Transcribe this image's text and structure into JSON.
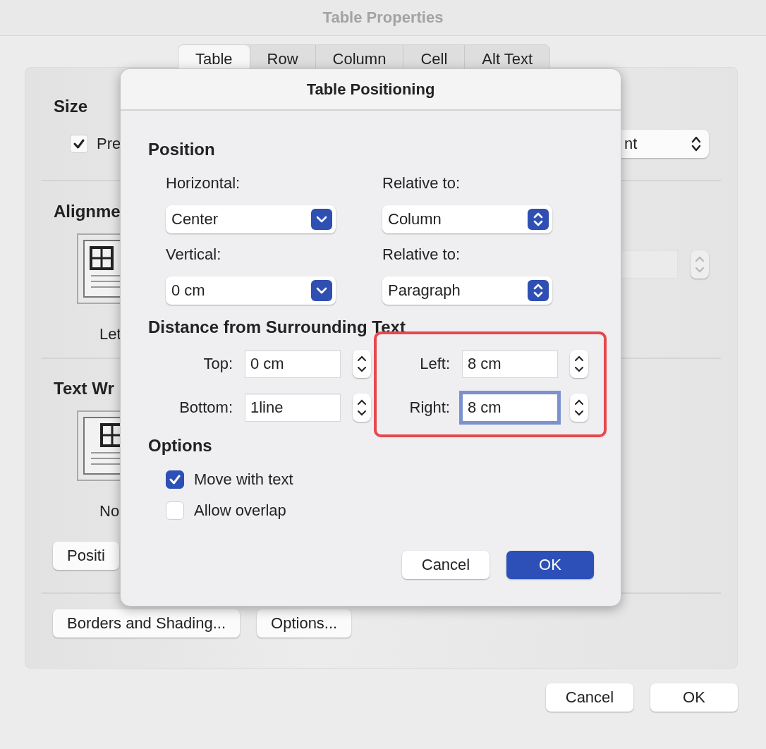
{
  "window": {
    "title": "Table Properties"
  },
  "tabs": [
    {
      "label": "Table",
      "selected": true
    },
    {
      "label": "Row",
      "selected": false
    },
    {
      "label": "Column",
      "selected": false
    },
    {
      "label": "Cell",
      "selected": false
    },
    {
      "label": "Alt Text",
      "selected": false
    }
  ],
  "size": {
    "heading": "Size",
    "checkbox": {
      "label": "Pre",
      "checked": true
    },
    "unit_select": {
      "value": "nt"
    }
  },
  "alignment": {
    "heading": "Alignme",
    "option_label": "Let",
    "indent_field": {
      "disabled": true
    }
  },
  "text_wrapping": {
    "heading": "Text Wr",
    "option_label": "No",
    "button": "Positi"
  },
  "buttons": [
    "Borders and Shading...",
    "Options..."
  ],
  "footer_buttons": [
    {
      "label": "Cancel",
      "default": false
    },
    {
      "label": "OK",
      "default": false
    }
  ],
  "sheet": {
    "title": "Table Positioning",
    "position": {
      "heading": "Position",
      "fields": [
        {
          "label": "Horizontal:",
          "value": "Center",
          "kind": "combo"
        },
        {
          "label": "Relative to:",
          "value": "Column",
          "kind": "popup"
        },
        {
          "label": "Vertical:",
          "value": "0 cm",
          "kind": "combo"
        },
        {
          "label": "Relative to:",
          "value": "Paragraph",
          "kind": "popup"
        }
      ]
    },
    "distance": {
      "heading": "Distance from Surrounding Text",
      "fields": [
        {
          "label": "Top:",
          "value": "0 cm",
          "focused": false
        },
        {
          "label": "Left:",
          "value": "8 cm",
          "focused": false
        },
        {
          "label": "Bottom:",
          "value": "1line",
          "focused": false
        },
        {
          "label": "Right:",
          "value": "8 cm",
          "focused": true
        }
      ]
    },
    "options": {
      "heading": "Options",
      "checkboxes": [
        {
          "label": "Move with text",
          "checked": true
        },
        {
          "label": "Allow overlap",
          "checked": false
        }
      ]
    },
    "buttons": [
      {
        "label": "Cancel",
        "default": false
      },
      {
        "label": "OK",
        "default": true
      }
    ]
  }
}
